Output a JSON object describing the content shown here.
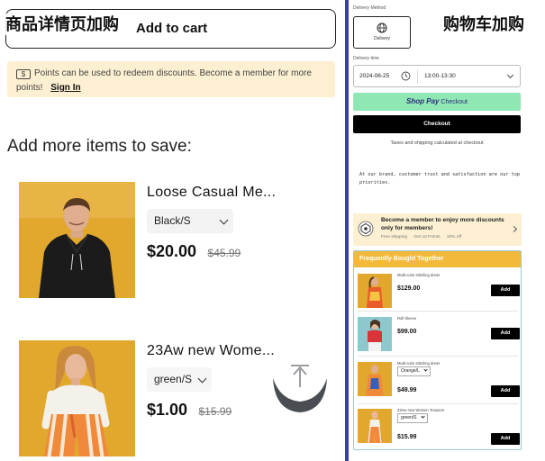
{
  "overlay_labels": {
    "left": "商品详情页加购",
    "right": "购物车加购"
  },
  "product_page": {
    "add_to_cart_label": "Add to cart",
    "points_banner": {
      "icon": "coin-icon",
      "text": "Points can be used to redeem discounts. Become a member for more points!",
      "sign_in_label": "Sign In"
    },
    "section_title": "Add more items to save:",
    "products": [
      {
        "name": "Loose Casual Me...",
        "variant": "Black/S",
        "price": "$20.00",
        "compare_price": "$45.99"
      },
      {
        "name": "23Aw new Wome...",
        "variant": "green/S",
        "price": "$1.00",
        "compare_price": "$15.99"
      }
    ],
    "scroll_top_icon": "arrow-up-icon"
  },
  "cart": {
    "delivery_method_label": "Delivery Method",
    "delivery_option_label": "Delivery",
    "delivery_option_icon": "globe-icon",
    "delivery_time_label": "Delivery time",
    "date": "2024-06-25",
    "time_range": "13:00-13:30",
    "shop_pay_brand": "Shop Pay",
    "shop_pay_checkout_label": "Checkout",
    "checkout_label": "Checkout",
    "tax_note": "Taxes and shipping calculated at checkout",
    "trust_note": "At our brand, customer trust and satisfaction are our top priorities.",
    "member_banner": {
      "title": "Become a member to enjoy more discounts only for members!",
      "perks": [
        "Free shipping",
        "Get 10 Points",
        "10% off"
      ]
    },
    "fbt": {
      "title": "Frequently Bought Together",
      "items": [
        {
          "name": "Multi-color stitching dress",
          "price": "$129.00",
          "add_label": "Add"
        },
        {
          "name": "Roll Sleeve",
          "price": "$99.00",
          "add_label": "Add"
        },
        {
          "name": "Multi-color stitching dress",
          "variant": "Orange/L",
          "price": "$49.99",
          "add_label": "Add"
        },
        {
          "name": "23Aw new Women Trousers",
          "variant": "green/S",
          "price": "$15.99",
          "add_label": "Add"
        }
      ]
    }
  },
  "colors": {
    "divider": "#3a3fa8",
    "banner_bg": "#fdf0d2",
    "shop_pay_bg": "#8fe8b3",
    "fbt_header": "#f2b93b",
    "photo_backdrop": "#e2a82e"
  }
}
